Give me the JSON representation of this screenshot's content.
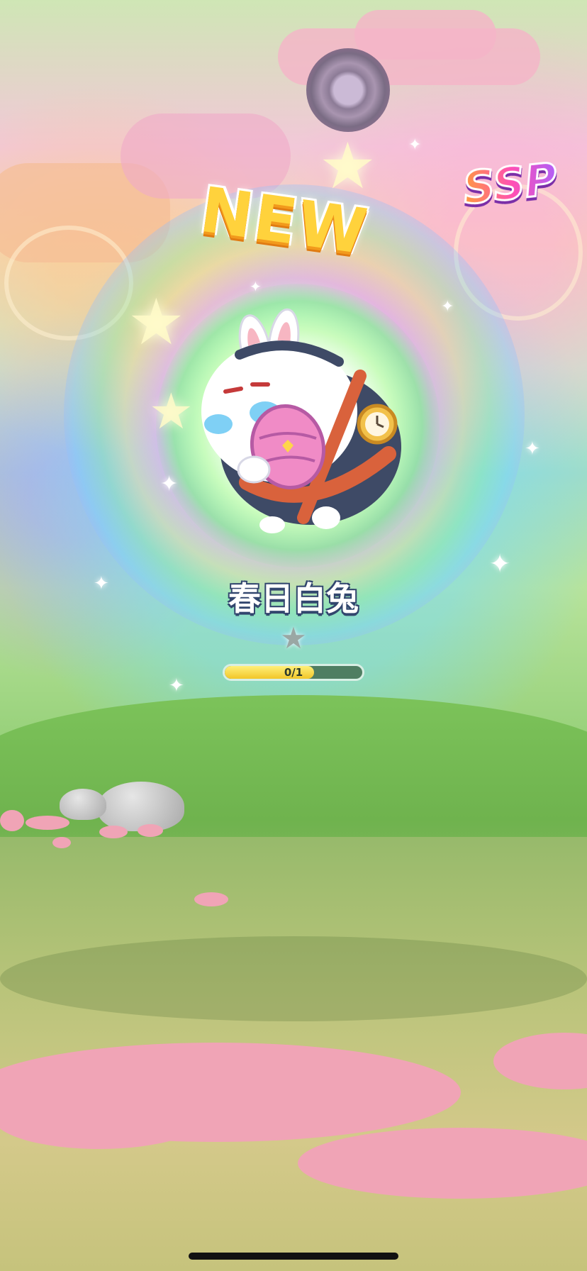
{
  "banner": {
    "new_label": "NEW",
    "rarity": "SSP"
  },
  "character": {
    "name": "春日白兔",
    "star_icon": "star-icon",
    "stars": 1
  },
  "progress": {
    "text": "0/1",
    "value": 0.65
  },
  "colors": {
    "badge_gradient": [
      "#ff9b3d",
      "#ff4fb5",
      "#a861ff"
    ],
    "new_text": "#ffd23c",
    "progress_fill": "#f2c628"
  }
}
